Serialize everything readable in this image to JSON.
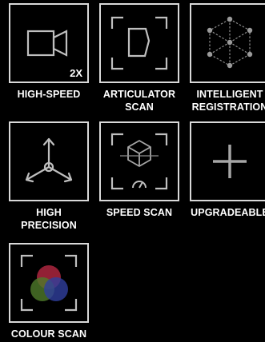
{
  "tiles": [
    {
      "label": "HIGH-SPEED",
      "icon": "video-camera-icon",
      "badge": "2X"
    },
    {
      "label": "ARTICULATOR\nSCAN",
      "icon": "articulator-scan-icon"
    },
    {
      "label": "INTELLIGENT\nREGISTRATION",
      "icon": "cube-network-icon"
    },
    {
      "label": "HIGH\nPRECISION",
      "icon": "tri-axis-icon"
    },
    {
      "label": "SPEED SCAN",
      "icon": "speed-scan-icon"
    },
    {
      "label": "UPGRADEABLE",
      "icon": "plus-icon"
    },
    {
      "label": "COLOUR SCAN",
      "icon": "colour-circles-icon"
    }
  ]
}
